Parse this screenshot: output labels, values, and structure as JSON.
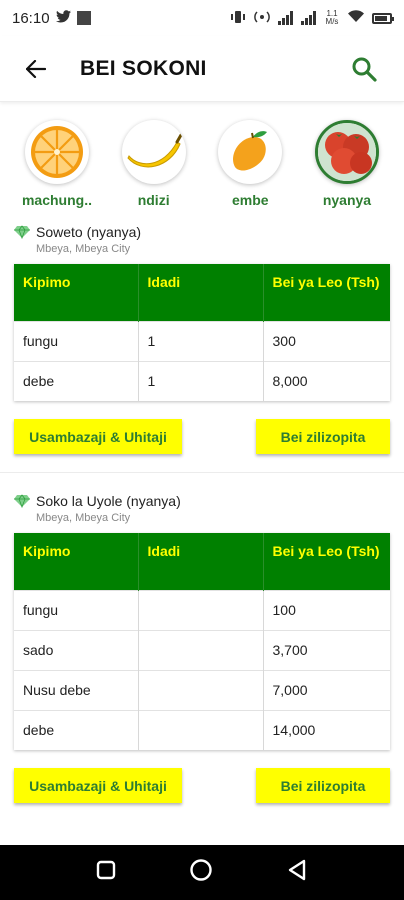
{
  "status": {
    "time": "16:10",
    "net_speed": "1.1\nM/s"
  },
  "app_bar": {
    "title": "BEI SOKONI"
  },
  "categories": [
    {
      "label": "machung..",
      "icon": "orange-icon",
      "selected": false
    },
    {
      "label": "ndizi",
      "icon": "banana-icon",
      "selected": false
    },
    {
      "label": "embe",
      "icon": "mango-icon",
      "selected": false
    },
    {
      "label": "nyanya",
      "icon": "tomato-icon",
      "selected": true
    }
  ],
  "markets": [
    {
      "name": "Soweto (nyanya)",
      "location": "Mbeya, Mbeya City",
      "headers": [
        "Kipimo",
        "Idadi",
        "Bei ya Leo (Tsh)"
      ],
      "rows": [
        [
          "fungu",
          "1",
          "300"
        ],
        [
          "debe",
          "1",
          "8,000"
        ]
      ],
      "buttons": {
        "left": "Usambazaji & Uhitaji",
        "right": "Bei zilizopita"
      }
    },
    {
      "name": "Soko la Uyole (nyanya)",
      "location": "Mbeya, Mbeya City",
      "headers": [
        "Kipimo",
        "Idadi",
        "Bei ya Leo (Tsh)"
      ],
      "rows": [
        [
          "fungu",
          "",
          "100"
        ],
        [
          "sado",
          "",
          "3,700"
        ],
        [
          "Nusu debe",
          "",
          "7,000"
        ],
        [
          "debe",
          "",
          "14,000"
        ]
      ],
      "buttons": {
        "left": "Usambazaji & Uhitaji",
        "right": "Bei zilizopita"
      }
    }
  ],
  "colors": {
    "primary_green": "#008000",
    "header_text_yellow": "#ffff00",
    "label_green": "#2e7d32"
  }
}
